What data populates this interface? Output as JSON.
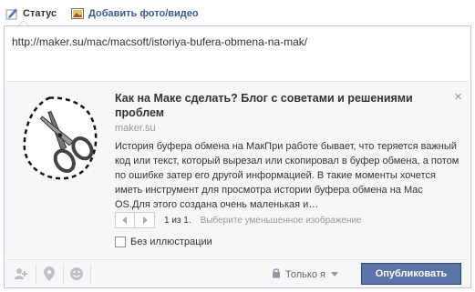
{
  "tabs": {
    "status_label": "Статус",
    "photo_label": "Добавить фото/видео"
  },
  "composer": {
    "text": "http://maker.su/mac/macsoft/istoriya-bufera-obmena-na-mak/"
  },
  "link_preview": {
    "title": "Как на Маке сделать? Блог с советами и решениями проблем",
    "domain": "maker.su",
    "description": "История буфера обмена на МакПри работе бывает, что теряется важный код или текст, который вырезал или скопировал в буфер обмена, а потом по ошибке затер его другой информацией. В такие моменты хочется иметь инструмент для просмотра истории буфера обмена на Mac OS.Для этого создана очень маленькая  и…",
    "close_glyph": "×",
    "pager": {
      "count": "1 из 1.",
      "hint": "Выберите уменьшенное изображение"
    },
    "no_image_label": "Без иллюстрации"
  },
  "bottom_bar": {
    "privacy_label": "Только я",
    "publish_label": "Опубликовать"
  },
  "colors": {
    "accent": "#3b5998",
    "publish_bg": "#5b74a8",
    "icon_gray": "#9197a3"
  },
  "icons": [
    "status-icon",
    "photo-icon",
    "scissors-thumbnail",
    "close-icon",
    "tag-people-icon",
    "location-icon",
    "feeling-icon",
    "lock-icon"
  ]
}
